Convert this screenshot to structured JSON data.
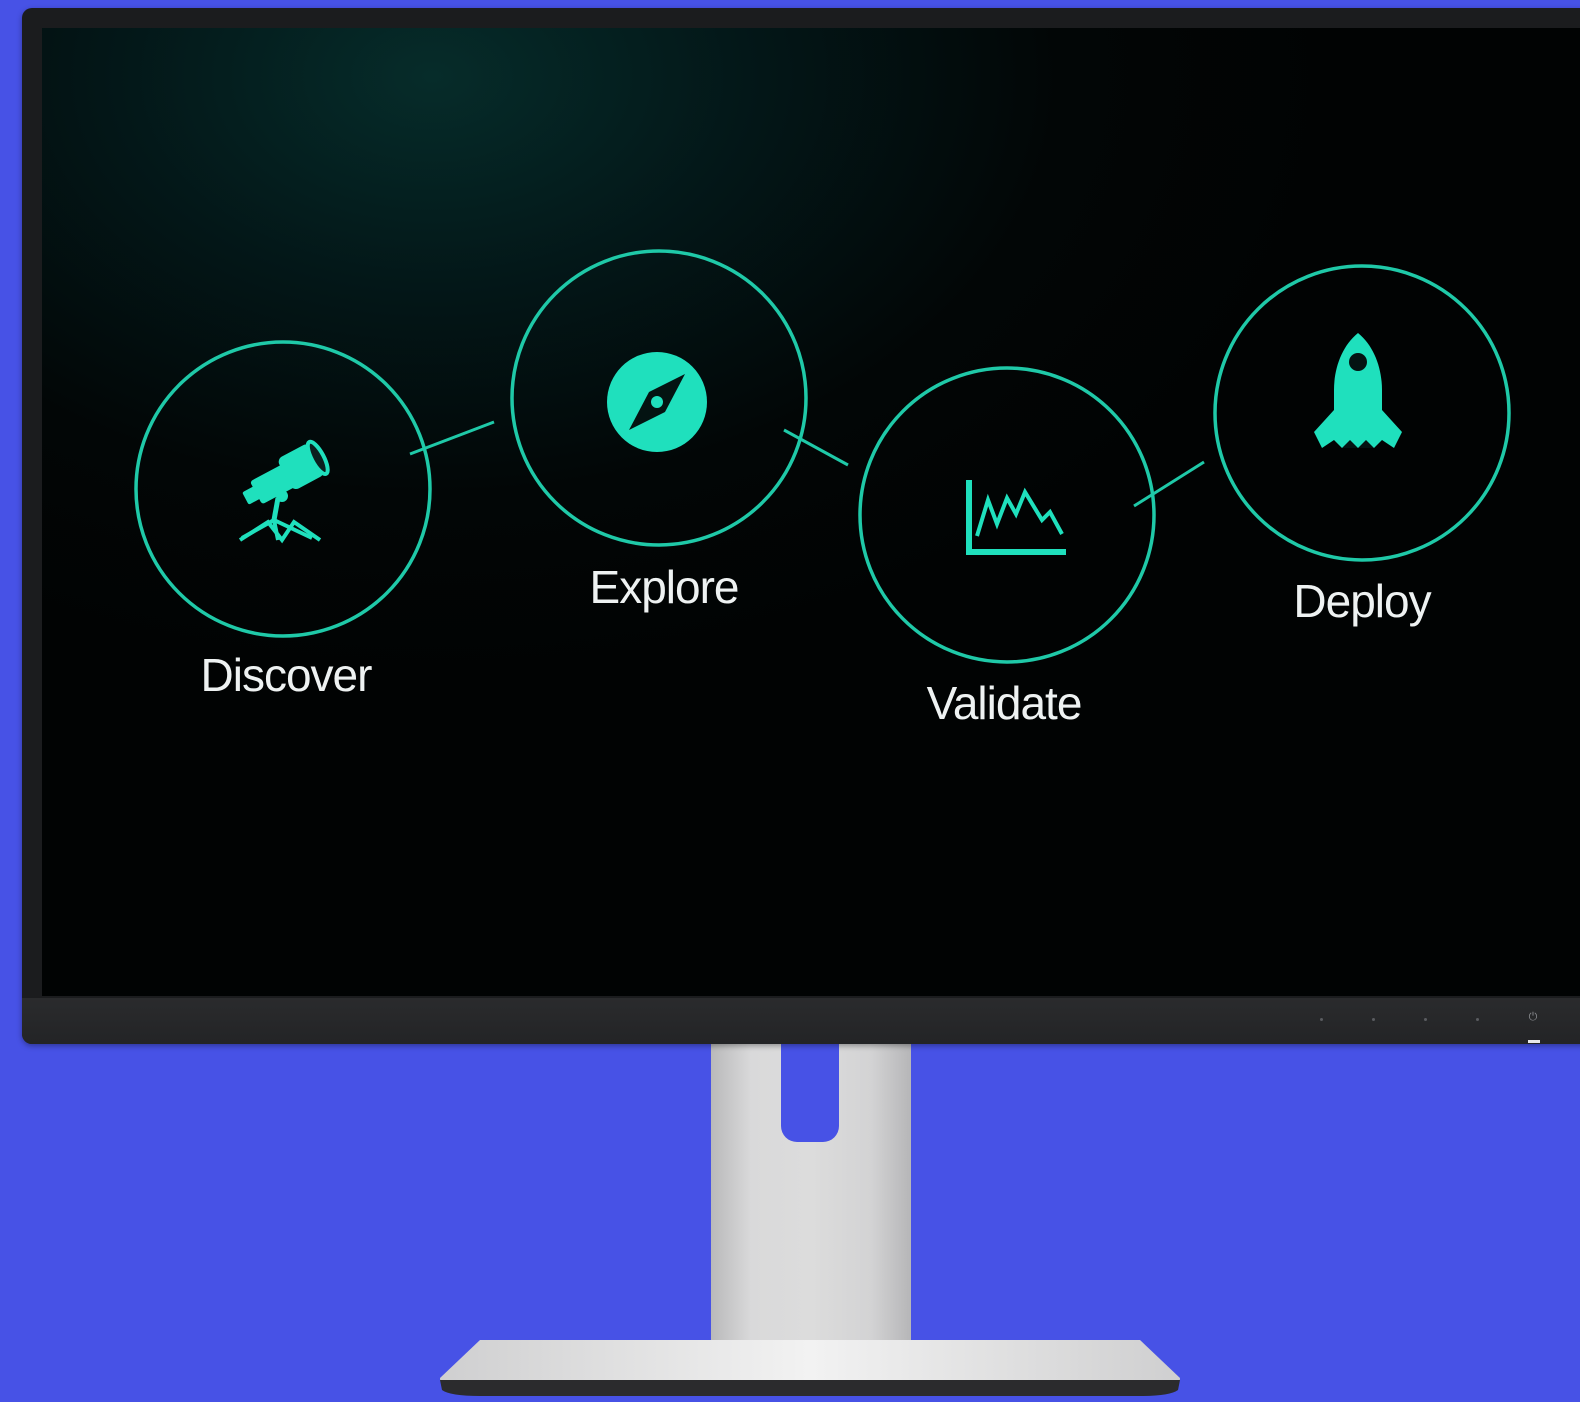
{
  "colors": {
    "background": "#4752e6",
    "accent": "#1fe0bd",
    "label": "#eef2f2",
    "bezel": "#1b1c1e"
  },
  "steps": [
    {
      "label": "Discover",
      "icon": "telescope-icon"
    },
    {
      "label": "Explore",
      "icon": "compass-icon"
    },
    {
      "label": "Validate",
      "icon": "line-chart-icon"
    },
    {
      "label": "Deploy",
      "icon": "rocket-icon"
    }
  ],
  "monitor": {
    "power_symbol": "⏻"
  }
}
